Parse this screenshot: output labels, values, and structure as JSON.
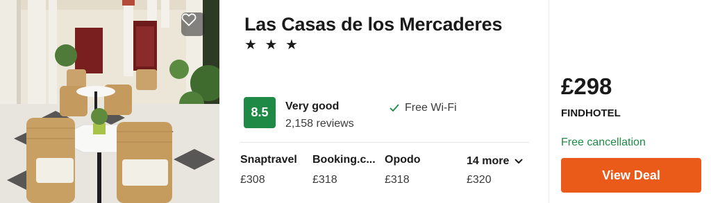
{
  "hotel": {
    "name": "Las Casas de los Mercaderes",
    "stars": "★ ★ ★"
  },
  "rating": {
    "score": "8.5",
    "label": "Very good",
    "reviews": "2,158 reviews",
    "color": "#1f8a46"
  },
  "amenity": {
    "icon": "check-icon",
    "label": "Free Wi-Fi"
  },
  "providers": [
    {
      "name": "Snaptravel",
      "price": "£308"
    },
    {
      "name": "Booking.c...",
      "price": "£318"
    },
    {
      "name": "Opodo",
      "price": "£318"
    }
  ],
  "more": {
    "label": "14 more",
    "price": "£320",
    "icon": "chevron-down-icon"
  },
  "deal": {
    "price": "£298",
    "seller": "FINDHOTEL",
    "cancellation": "Free cancellation",
    "button_label": "View Deal",
    "button_color": "#ea5a18"
  },
  "photo": {
    "favorite_icon": "heart-icon"
  }
}
